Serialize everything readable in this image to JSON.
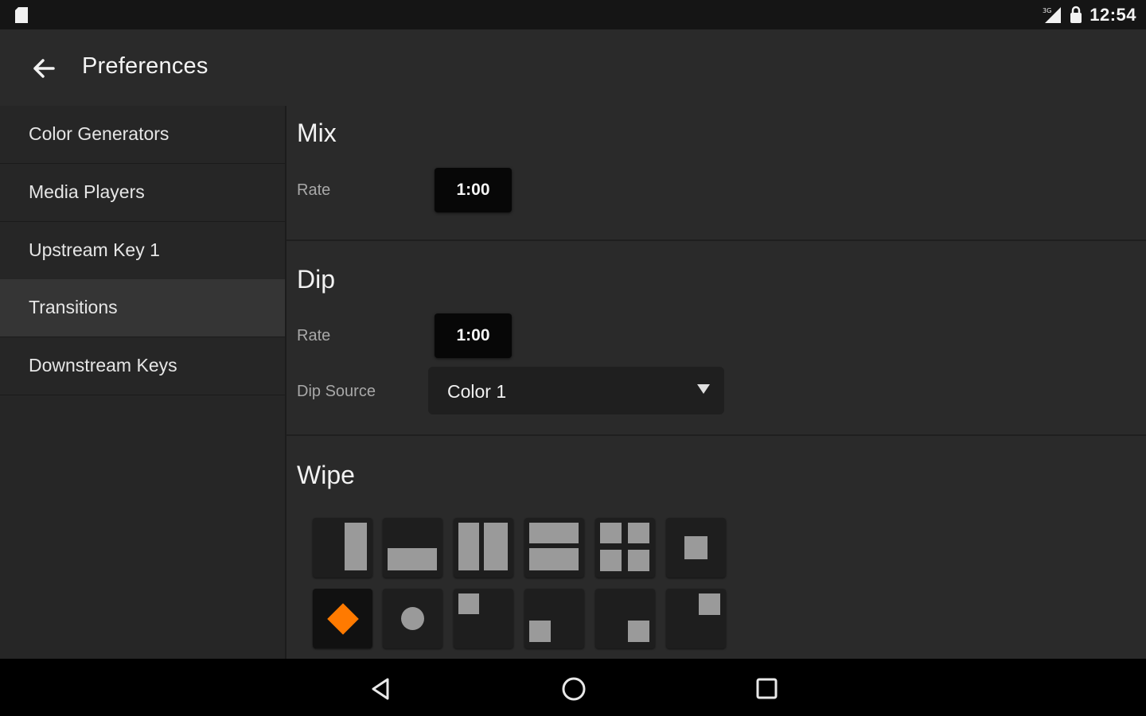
{
  "status_bar": {
    "time": "12:54",
    "icons": [
      "sd-card-icon",
      "signal-icon",
      "lock-icon"
    ]
  },
  "app_bar": {
    "title": "Preferences",
    "back_icon": "arrow-back-icon"
  },
  "sidebar": {
    "items": [
      {
        "label": "Color Generators",
        "active": false
      },
      {
        "label": "Media Players",
        "active": false
      },
      {
        "label": "Upstream Key 1",
        "active": false
      },
      {
        "label": "Transitions",
        "active": true
      },
      {
        "label": "Downstream Keys",
        "active": false
      }
    ]
  },
  "mix": {
    "title": "Mix",
    "rate_label": "Rate",
    "rate_value": "1:00"
  },
  "dip": {
    "title": "Dip",
    "rate_label": "Rate",
    "rate_value": "1:00",
    "source_label": "Dip Source",
    "source_value": "Color 1"
  },
  "wipe": {
    "title": "Wipe",
    "patterns": [
      "horizontal-wipe",
      "vertical-wipe",
      "horizontal-barn-door",
      "vertical-barn-door",
      "four-box",
      "box-iris",
      "diamond-iris",
      "circle-iris",
      "top-left-corner",
      "bottom-left-corner",
      "bottom-right-corner",
      "top-right-corner"
    ],
    "selected": "diamond-iris"
  },
  "colors": {
    "accent": "#ff7a00",
    "background": "#2a2a2a",
    "sidebar_active": "#353535"
  },
  "nav_bar": {
    "icons": [
      "back-triangle-icon",
      "home-circle-icon",
      "recents-square-icon"
    ]
  }
}
